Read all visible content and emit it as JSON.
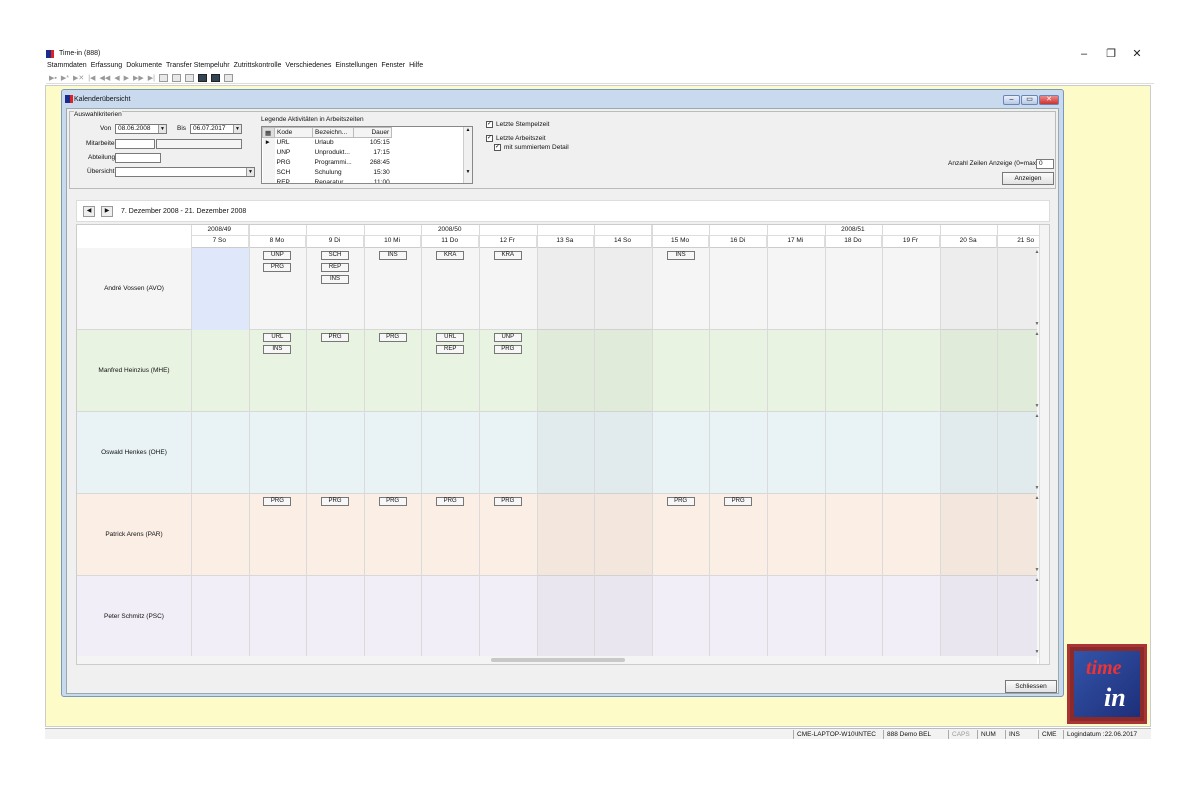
{
  "app": {
    "title": "Time-in (888)",
    "window_controls": {
      "minimize": "–",
      "restore": "❐",
      "close": "✕"
    }
  },
  "menu": [
    "Stammdaten",
    "Erfassung",
    "Dokumente",
    "Transfer Stempeluhr",
    "Zutrittskontrolle",
    "Verschiedenes",
    "Einstellungen",
    "Fenster",
    "Hilfe"
  ],
  "toolbar": [
    "▶▪",
    "▶*",
    "▶✕",
    "|◀",
    "◀◀",
    "◀",
    "▶",
    "▶▶",
    "▶|"
  ],
  "dialog": {
    "title": "Kalenderübersicht",
    "group_label": "Auswahlkriterien",
    "von_label": "Von",
    "von_value": "08.06.2008",
    "bis_label": "Bis",
    "bis_value": "06.07.2017",
    "mitarbeiter_label": "Mitarbeiter",
    "abteilung_label": "Abteilung",
    "uebersicht_label": "Übersicht",
    "legend_title": "Legende Aktivitäten in Arbeitszeiten",
    "legend_headers": [
      "Kode",
      "Bezeichn...",
      "Dauer"
    ],
    "legend_rows": [
      {
        "code": "URL",
        "name": "Urlaub",
        "dauer": "105:15"
      },
      {
        "code": "UNP",
        "name": "Unprodukt...",
        "dauer": "17:15"
      },
      {
        "code": "PRG",
        "name": "Programmi...",
        "dauer": "268:45"
      },
      {
        "code": "SCH",
        "name": "Schulung",
        "dauer": "15:30"
      },
      {
        "code": "REP",
        "name": "Reparatur",
        "dauer": "11:00"
      }
    ],
    "cb_stempelzeit": "Letzte Stempelzeit",
    "cb_arbeitszeit": "Letzte Arbeitszeit",
    "cb_detail": "mit summiertem Detail",
    "anzahl_label": "Anzahl Zeilen Anzeige (0=max)",
    "anzahl_value": "0",
    "anzeigen_button": "Anzeigen",
    "schliessen_button": "Schliessen"
  },
  "calendar": {
    "range": "7. Dezember 2008 - 21. Dezember 2008",
    "weeks": [
      "2008/49",
      "2008/50",
      "2008/51"
    ],
    "days": [
      "7 So",
      "8 Mo",
      "9 Di",
      "10 Mi",
      "11 Do",
      "12 Fr",
      "13 Sa",
      "14 So",
      "15 Mo",
      "16 Di",
      "17 Mi",
      "18 Do",
      "19 Fr",
      "20 Sa",
      "21 So"
    ],
    "employees": [
      {
        "name": "André Vossen (AVO)",
        "color": "#f5f5f5",
        "acts": [
          [
            1,
            0,
            "UNP"
          ],
          [
            1,
            1,
            "PRG"
          ],
          [
            2,
            0,
            "SCH"
          ],
          [
            2,
            1,
            "REP"
          ],
          [
            2,
            2,
            "INS"
          ],
          [
            3,
            0,
            "INS"
          ],
          [
            4,
            0,
            "KRA"
          ],
          [
            5,
            0,
            "KRA"
          ],
          [
            8,
            0,
            "INS"
          ]
        ]
      },
      {
        "name": "Manfred Heinzius (MHE)",
        "color": "#e9f3e2",
        "acts": [
          [
            1,
            0,
            "URL"
          ],
          [
            1,
            1,
            "INS"
          ],
          [
            2,
            0,
            "PRG"
          ],
          [
            3,
            0,
            "PRG"
          ],
          [
            4,
            0,
            "URL"
          ],
          [
            4,
            1,
            "REP"
          ],
          [
            5,
            0,
            "UNP"
          ],
          [
            5,
            1,
            "PRG"
          ]
        ]
      },
      {
        "name": "Oswald Henkes (OHE)",
        "color": "#e9f3f6",
        "acts": []
      },
      {
        "name": "Patrick Arens (PAR)",
        "color": "#fbeee4",
        "acts": [
          [
            1,
            0,
            "PRG"
          ],
          [
            2,
            0,
            "PRG"
          ],
          [
            3,
            0,
            "PRG"
          ],
          [
            4,
            0,
            "PRG"
          ],
          [
            5,
            0,
            "PRG"
          ],
          [
            8,
            0,
            "PRG"
          ],
          [
            9,
            0,
            "PRG"
          ]
        ]
      },
      {
        "name": "Peter Schmitz (PSC)",
        "color": "#f2eef7",
        "acts": []
      }
    ]
  },
  "status": {
    "computer": "CME-LAPTOP-W10\\INTEC",
    "demo": "888 Demo BEL",
    "caps": "CAPS",
    "num": "NUM",
    "ins": "INS",
    "user": "CME",
    "logindatum": "Logindatum :22.06.2017"
  },
  "logo": {
    "line1": "time",
    "line2": "in"
  }
}
